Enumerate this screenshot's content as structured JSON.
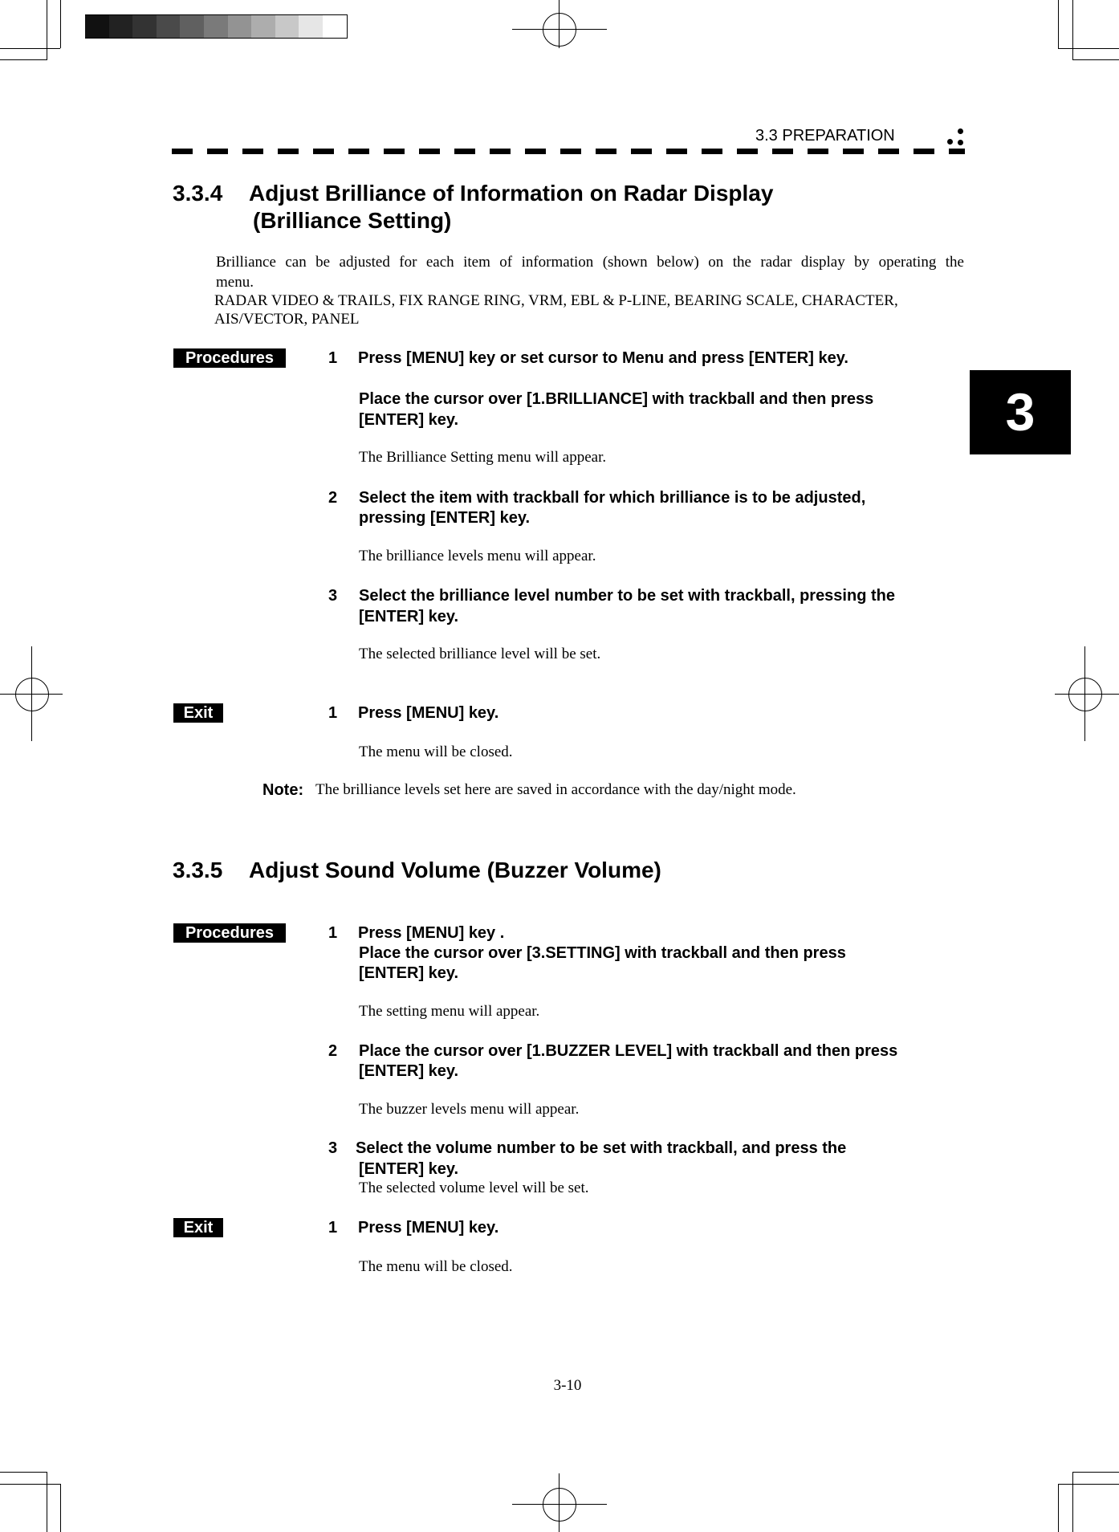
{
  "header": {
    "section": "3.3   PREPARATION"
  },
  "chapter_tab": "3",
  "colors": {
    "text": "#000000",
    "badge_bg": "#000000",
    "badge_text": "#ffffff",
    "tab_bg": "#000000"
  },
  "s334": {
    "number": "3.3.4",
    "title_line1": "Adjust Brilliance of Information on Radar Display",
    "title_line2": "(Brilliance Setting)",
    "intro_line1": "Brilliance can be adjusted for each item of information (shown below) on the radar display by operating the",
    "intro_line2": "menu.",
    "items_line1": "RADAR VIDEO & TRAILS, FIX RANGE RING, VRM, EBL & P-LINE, BEARING SCALE, CHARACTER,",
    "items_line2": "AIS/VECTOR, PANEL",
    "procedures_label": "Procedures",
    "steps": [
      {
        "num": "1",
        "line1": "Press [MENU] key or set cursor to Menu and press [ENTER] key.",
        "line2": "Place the cursor over [1.BRILLIANCE] with trackball and then press",
        "line3": "[ENTER] key.",
        "result": "The Brilliance Setting menu will appear."
      },
      {
        "num": "2",
        "line1": "Select the item with trackball for which brilliance is to be adjusted,",
        "line2": "pressing [ENTER] key.",
        "result": "The brilliance levels menu will appear."
      },
      {
        "num": "3",
        "line1": "Select the brilliance level number to be set with trackball, pressing the",
        "line2": "[ENTER] key.",
        "result": "The selected brilliance level will be set."
      }
    ],
    "exit_label": "Exit",
    "exit_step": {
      "num": "1",
      "line1": "Press [MENU] key.",
      "result": "The menu will be closed."
    },
    "note_label": "Note:",
    "note_text": "The brilliance levels set here are saved in accordance with the day/night mode."
  },
  "s335": {
    "number": "3.3.5",
    "title": "Adjust Sound Volume (Buzzer Volume)",
    "procedures_label": "Procedures",
    "steps": [
      {
        "num": "1",
        "line1": "Press [MENU] key .",
        "line2": "Place the cursor over [3.SETTING] with trackball and then press",
        "line3": "[ENTER] key.",
        "result": "The setting menu will appear."
      },
      {
        "num": "2",
        "line1": "Place the cursor over [1.BUZZER LEVEL] with trackball and then press",
        "line2": "[ENTER] key.",
        "result": "The buzzer levels menu will appear."
      },
      {
        "num": "3",
        "line1": "Select the volume number to be set with trackball, and press the",
        "line2": "[ENTER] key.",
        "result": "The selected volume level will be set."
      }
    ],
    "exit_label": "Exit",
    "exit_step": {
      "num": "1",
      "line1": "Press [MENU] key.",
      "result": "The menu will be closed."
    }
  },
  "page_number": "3-10"
}
